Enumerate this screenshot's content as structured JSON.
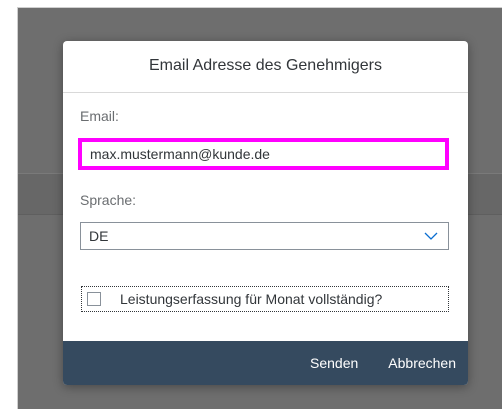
{
  "dialog": {
    "title": "Email Adresse des Genehmigers",
    "email": {
      "label": "Email:",
      "value": "max.mustermann@kunde.de"
    },
    "language": {
      "label": "Sprache:",
      "selected": "DE"
    },
    "checkbox": {
      "label": "Leistungserfassung für Monat vollständig?",
      "checked": false
    },
    "buttons": {
      "send_label": "Senden",
      "cancel_label": "Abbrechen"
    }
  },
  "colors": {
    "footer": "#354a5f",
    "highlight": "#ff00ff",
    "backdrop": "#6e6e6e"
  },
  "icons": {
    "select": "chevron-down-icon"
  }
}
